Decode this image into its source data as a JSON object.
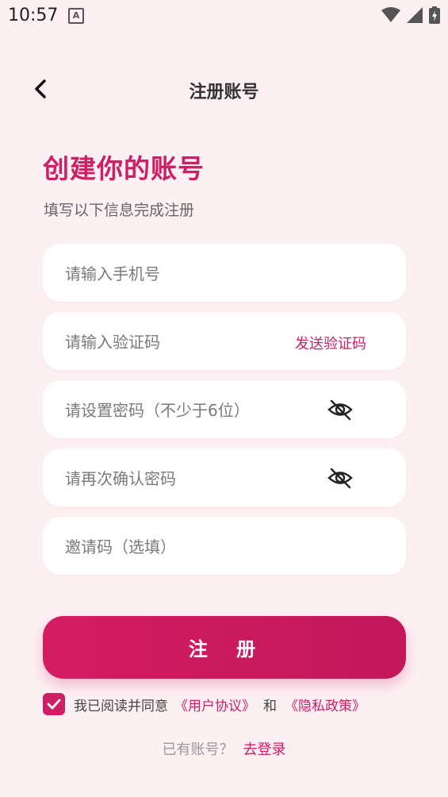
{
  "status_bar": {
    "time": "10:57",
    "notification_badge": "A"
  },
  "header": {
    "title": "注册账号"
  },
  "intro": {
    "heading": "创建你的账号",
    "subheading": "填写以下信息完成注册"
  },
  "form": {
    "phone_placeholder": "请输入手机号",
    "code_placeholder": "请输入验证码",
    "send_code_label": "发送验证码",
    "password_placeholder": "请设置密码（不少于6位）",
    "confirm_placeholder": "请再次确认密码",
    "invite_placeholder": "邀请码（选填）"
  },
  "register_button_label": "注 册",
  "agreement": {
    "checked": true,
    "prefix": "我已阅读并同意",
    "user_agreement": "《用户协议》",
    "and": "和",
    "privacy_policy": "《隐私政策》"
  },
  "login_prompt": {
    "text": "已有账号？",
    "link": "去登录"
  },
  "colors": {
    "accent": "#cc1f66",
    "background": "#fdf0f3"
  },
  "icons": [
    "back-chevron-icon",
    "eye-off-icon",
    "check-icon",
    "wifi-icon",
    "signal-icon",
    "battery-icon"
  ]
}
